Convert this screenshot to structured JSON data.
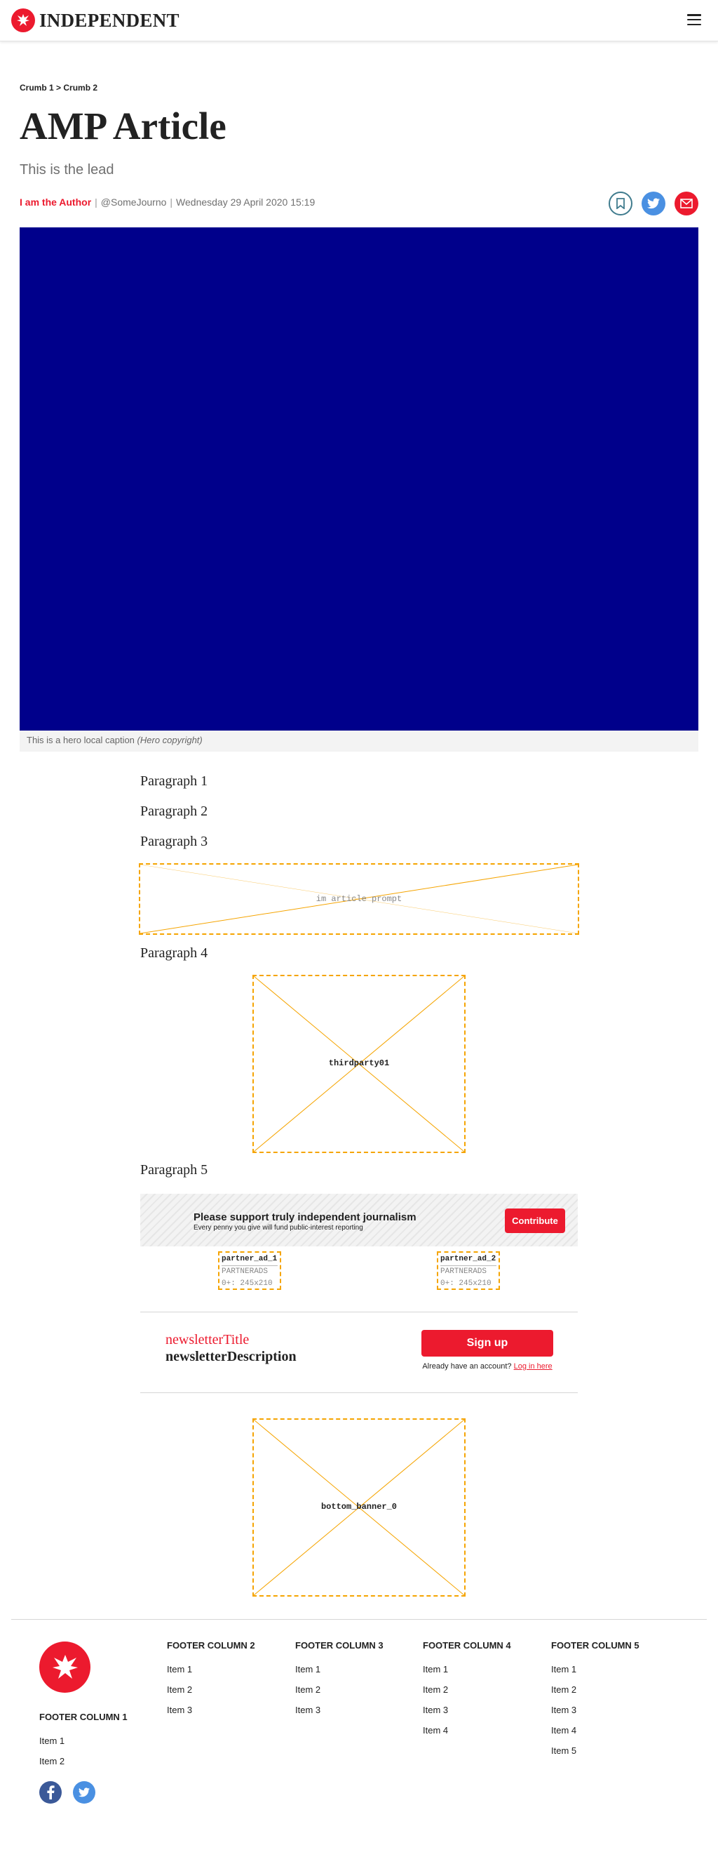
{
  "header": {
    "brand": "INDEPENDENT",
    "brand_color": "#ec1a2e"
  },
  "article": {
    "breadcrumb": [
      "Crumb 1",
      "Crumb 2"
    ],
    "breadcrumb_separator": ">",
    "title": "AMP Article",
    "lead": "This is the lead",
    "author": "I am the Author",
    "handle": "@SomeJourno",
    "date": "Wednesday 29 April 2020 15:19",
    "hero_color": "#00008b",
    "caption": "This is a hero local caption",
    "caption_copyright": "(Hero copyright)",
    "paragraphs": [
      "Paragraph 1",
      "Paragraph 2",
      "Paragraph 3",
      "Paragraph 4",
      "Paragraph 5"
    ]
  },
  "ads": {
    "inarticle": "im article prompt",
    "thirdparty": "thirdparty01",
    "bottom": "bottom_banner_0",
    "partners": [
      {
        "name": "partner_ad_1",
        "network": "PARTNERADS",
        "size": "0+: 245x210"
      },
      {
        "name": "partner_ad_2",
        "network": "PARTNERADS",
        "size": "0+: 245x210"
      }
    ]
  },
  "contribute": {
    "title": "Please support truly independent journalism",
    "subtitle": "Every penny you give will fund public-interest reporting",
    "button": "Contribute"
  },
  "newsletter": {
    "title": "newsletterTitle",
    "description": "newsletterDescription",
    "button": "Sign up",
    "login_prompt": "Already have an account?",
    "login_link": "Log in here"
  },
  "footer": {
    "columns": [
      {
        "title": "FOOTER COLUMN 1",
        "items": [
          "Item 1",
          "Item 2"
        ]
      },
      {
        "title": "FOOTER COLUMN 2",
        "items": [
          "Item 1",
          "Item 2",
          "Item 3"
        ]
      },
      {
        "title": "FOOTER COLUMN 3",
        "items": [
          "Item 1",
          "Item 2",
          "Item 3"
        ]
      },
      {
        "title": "FOOTER COLUMN 4",
        "items": [
          "Item 1",
          "Item 2",
          "Item 3",
          "Item 4"
        ]
      },
      {
        "title": "FOOTER COLUMN 5",
        "items": [
          "Item 1",
          "Item 2",
          "Item 3",
          "Item 4",
          "Item 5"
        ]
      }
    ],
    "social": [
      "facebook-icon",
      "twitter-icon"
    ]
  }
}
